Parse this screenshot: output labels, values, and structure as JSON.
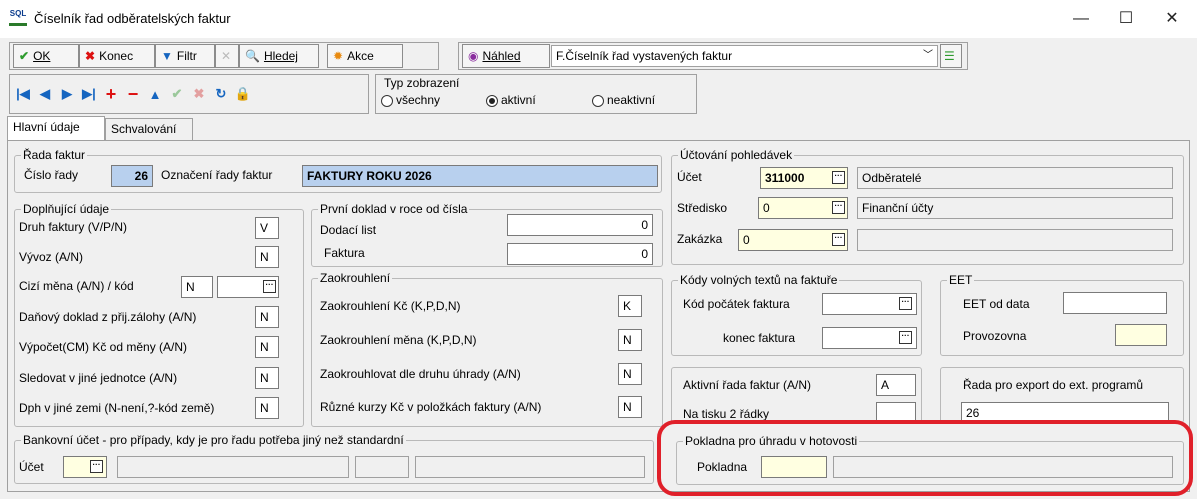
{
  "window": {
    "title": "Číselník řad odběratelských faktur",
    "app_icon_text": "SQL"
  },
  "toolbar1": {
    "ok": "OK",
    "konec": "Konec",
    "filtr": "Filtr",
    "hledej": "Hledej",
    "akce": "Akce",
    "nahled": "Náhled",
    "report_combo": "F.Číselník řad vystavených faktur"
  },
  "view_type": {
    "title": "Typ zobrazení",
    "options": [
      "všechny",
      "aktivní",
      "neaktivní"
    ],
    "selected": "aktivní"
  },
  "tabs": [
    "Hlavní údaje",
    "Schvalování"
  ],
  "rada": {
    "title": "Řada faktur",
    "cislo_label": "Číslo řady",
    "cislo_value": "26",
    "oznaceni_label": "Označení řady faktur",
    "oznaceni_value": "FAKTURY ROKU 2026"
  },
  "doplnujici": {
    "title": "Doplňující údaje",
    "rows": [
      {
        "label": "Druh faktury (V/P/N)",
        "value": "V"
      },
      {
        "label": "Vývoz (A/N)",
        "value": "N"
      },
      {
        "label": "Cizí měna (A/N) / kód",
        "value": "N"
      },
      {
        "label": "Daňový doklad z přij.zálohy (A/N)",
        "value": "N"
      },
      {
        "label": "Výpočet(CM) Kč od měny (A/N)",
        "value": "N"
      },
      {
        "label": "Sledovat v jiné jednotce (A/N)",
        "value": "N"
      },
      {
        "label": "Dph v jiné zemi (N-není,?-kód země)",
        "value": "N"
      }
    ]
  },
  "prvni_doklad": {
    "title": "První doklad v roce od čísla",
    "dodaci_label": "Dodací list",
    "dodaci_value": "0",
    "faktura_label": "Faktura",
    "faktura_value": "0"
  },
  "zaokrouhleni": {
    "title": "Zaokrouhlení",
    "rows": [
      {
        "label": "Zaokrouhlení Kč (K,P,D,N)",
        "value": "K"
      },
      {
        "label": "Zaokrouhlení měna (K,P,D,N)",
        "value": "N"
      },
      {
        "label": "Zaokrouhlovat dle druhu úhrady (A/N)",
        "value": "N"
      },
      {
        "label": "Různé kurzy Kč v položkách faktury (A/N)",
        "value": "N"
      }
    ]
  },
  "uctovani": {
    "title": "Účtování pohledávek",
    "ucet_label": "Účet",
    "ucet_value": "311000",
    "ucet_name": "Odběratelé",
    "stredisko_label": "Středisko",
    "stredisko_value": "0",
    "stredisko_name": "Finanční účty",
    "zakazka_label": "Zakázka",
    "zakazka_value": "0"
  },
  "kody": {
    "title": "Kódy volných textů na faktuře",
    "pocatek_label": "Kód počátek faktura",
    "konec_label": "konec faktura"
  },
  "eet": {
    "title": "EET",
    "od_data_label": "EET od data",
    "provozovna_label": "Provozovna"
  },
  "aktivni": {
    "label": "Aktivní řada faktur (A/N)",
    "value": "A",
    "tisk_label": "Na tisku 2 řádky"
  },
  "export": {
    "label": "Řada pro export do ext. programů",
    "value": "26"
  },
  "bankovni": {
    "title": "Bankovní účet - pro případy, kdy je pro řadu potřeba jiný než standardní",
    "ucet_label": "Účet"
  },
  "pokladna": {
    "title": "Pokladna pro úhradu v hotovosti",
    "label": "Pokladna"
  },
  "colors": {
    "highlight": "#e0202a",
    "selected_field": "#b8d0ee",
    "required_field": "#ffffe1"
  }
}
